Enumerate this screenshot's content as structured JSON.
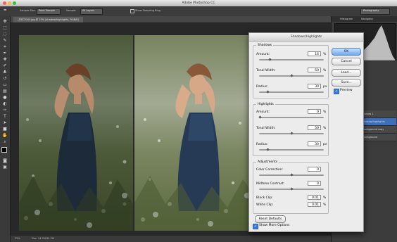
{
  "app": {
    "title": "Adobe Photoshop CC",
    "apple_menu": "",
    "status_zoom": "25%",
    "status_doc": "Doc: 34.2M/34.2M"
  },
  "options_bar": {
    "sample_label": "Sample Size:",
    "sample_value": "Point Sample",
    "sample_all": "All Layers",
    "show_ring": "Show Sampling Ring",
    "workspace": "Photography"
  },
  "document_tab": "_DSC3044.jpg @ 25% (shadow/highlights, RGB/8)",
  "right_panel": {
    "tab_histogram": "Histogram",
    "tab_navigator": "Navigator",
    "layers": [
      "Curves 1",
      "shadow/highlights",
      "Background copy",
      "Background"
    ]
  },
  "dialog": {
    "title": "Shadows/Highlights",
    "shadows": {
      "label": "Shadows",
      "amount_label": "Amount:",
      "amount": "16",
      "amount_unit": "%",
      "tonal_label": "Tonal Width:",
      "tonal": "50",
      "tonal_unit": "%",
      "radius_label": "Radius:",
      "radius": "30",
      "radius_unit": "px"
    },
    "highlights": {
      "label": "Highlights",
      "amount_label": "Amount:",
      "amount": "0",
      "amount_unit": "%",
      "tonal_label": "Tonal Width:",
      "tonal": "50",
      "tonal_unit": "%",
      "radius_label": "Radius:",
      "radius": "30",
      "radius_unit": "px"
    },
    "adjustments": {
      "label": "Adjustments",
      "color_label": "Color Correction:",
      "color": "0",
      "midtone_label": "Midtone Contrast:",
      "midtone": "0",
      "black_label": "Black Clip:",
      "black": "0.01",
      "black_unit": "%",
      "white_label": "White Clip:",
      "white": "0.01",
      "white_unit": "%"
    },
    "buttons": {
      "ok": "OK",
      "cancel": "Cancel",
      "load": "Load...",
      "save": "Save..."
    },
    "preview_label": "Preview",
    "reset_label": "Reset Defaults",
    "show_more_label": "Show More Options",
    "slider_levels": {
      "sh_amount": 0.16,
      "sh_tonal": 0.5,
      "sh_radius": 0.12,
      "hl_amount": 0.0,
      "hl_tonal": 0.5,
      "hl_radius": 0.12,
      "color": 0.5,
      "midtone": 0.5
    }
  },
  "colors": {
    "accent": "#3b7ee0",
    "ui_dark": "#3c3c3c",
    "dialog_bg": "#ececec"
  }
}
